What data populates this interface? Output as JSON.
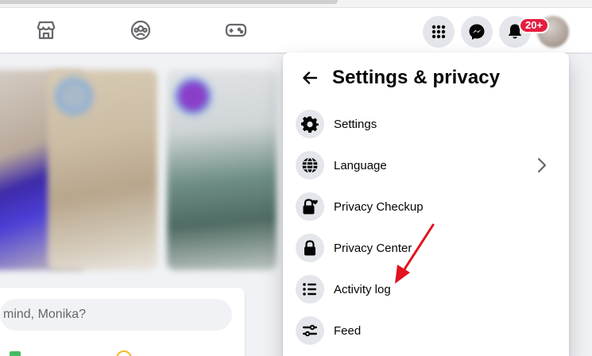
{
  "nav": {
    "notification_badge": "20+"
  },
  "composer": {
    "placeholder": "mind, Monika?"
  },
  "settings_menu": {
    "title": "Settings & privacy",
    "items": [
      {
        "label": "Settings",
        "icon": "gear-icon",
        "has_chevron": false
      },
      {
        "label": "Language",
        "icon": "globe-icon",
        "has_chevron": true
      },
      {
        "label": "Privacy Checkup",
        "icon": "lock-heart-icon",
        "has_chevron": false
      },
      {
        "label": "Privacy Center",
        "icon": "lock-icon",
        "has_chevron": false
      },
      {
        "label": "Activity log",
        "icon": "list-icon",
        "has_chevron": false
      },
      {
        "label": "Feed",
        "icon": "sliders-icon",
        "has_chevron": false
      }
    ]
  },
  "colors": {
    "badge": "#e41e3f",
    "annotation_arrow": "#e0131f",
    "icon_bg": "#e4e6eb",
    "nav_icon": "#65676b"
  }
}
